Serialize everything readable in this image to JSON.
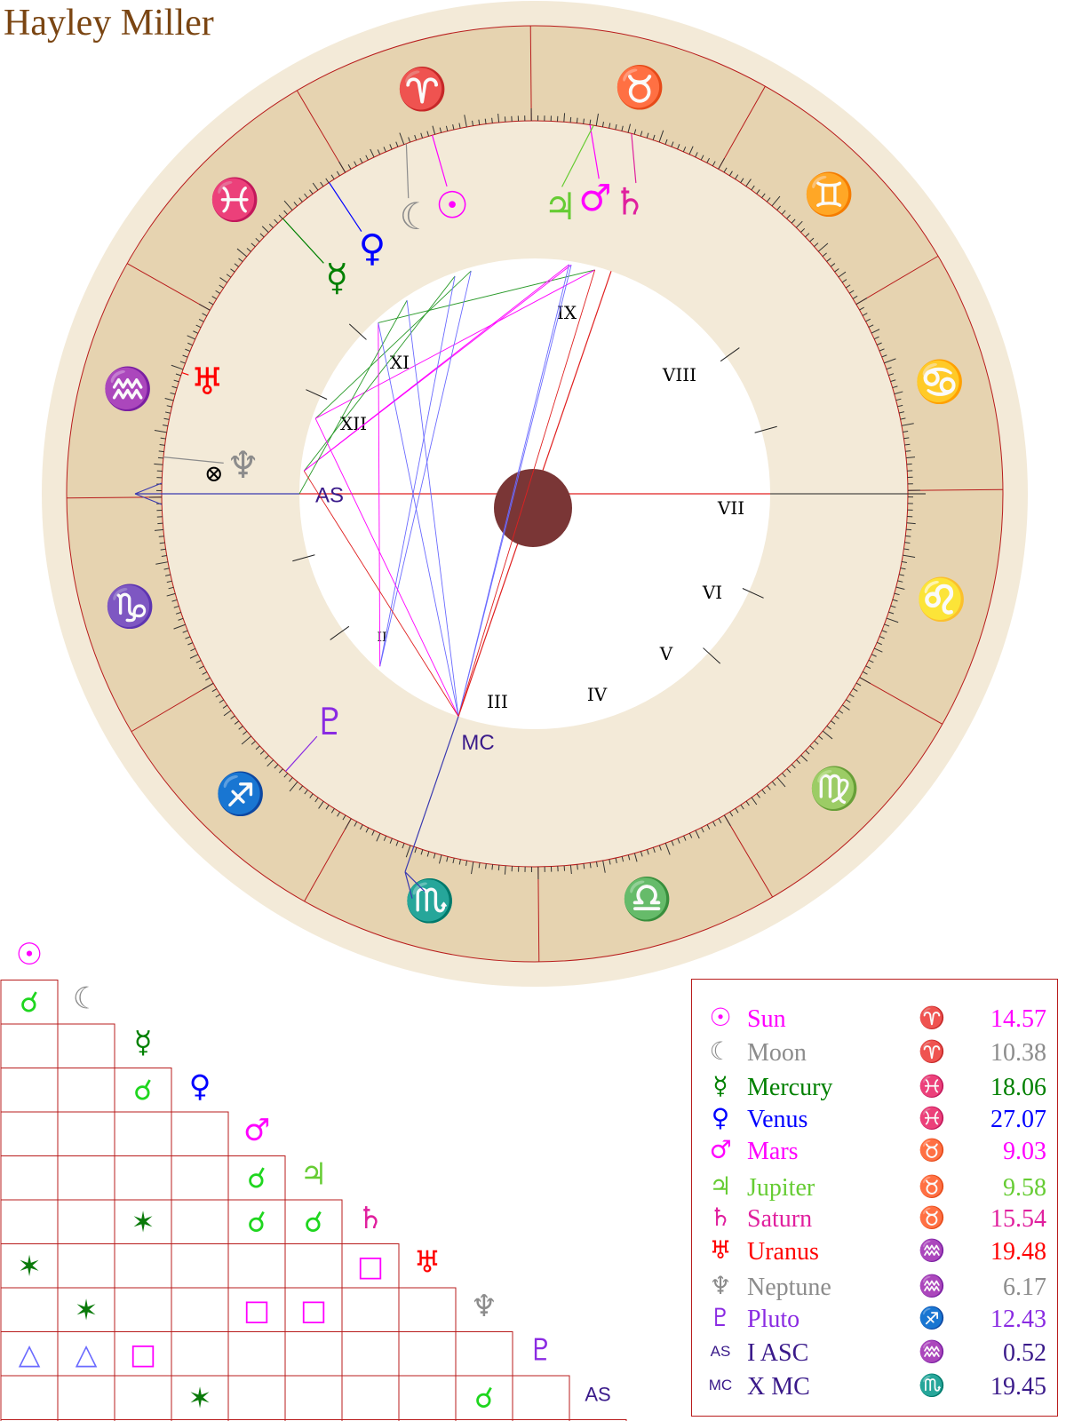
{
  "title": "Hayley Miller",
  "colors": {
    "ring_outer": "#f3ead8",
    "zodiac_band": "#e6d3b0",
    "house_band": "#f3ead8",
    "center": "#7a3636",
    "grid_line": "#b81c1c",
    "fire": "#ff1a1a",
    "earth": "#1fd61f",
    "air": "#e61ea8",
    "water": "#e61ea8",
    "sun": "#ff00ff",
    "moon": "#8c8c8c",
    "mercury": "#008000",
    "venus": "#0000ff",
    "mars": "#ff00ff",
    "jupiter": "#66cc33",
    "saturn": "#e0209e",
    "uranus": "#ff0000",
    "neptune": "#8c8c8c",
    "pluto": "#8a2be2",
    "asc": "#3a1a8a",
    "mc": "#3a1a8a"
  },
  "zodiac_signs": [
    {
      "name": "aries-sign-icon",
      "glyph": "♈",
      "color": "#ff1a1a"
    },
    {
      "name": "taurus-sign-icon",
      "glyph": "♉",
      "color": "#1fd61f"
    },
    {
      "name": "gemini-sign-icon",
      "glyph": "♊",
      "color": "#e61ea8"
    },
    {
      "name": "cancer-sign-icon",
      "glyph": "♋",
      "color": "#ff1a1a"
    },
    {
      "name": "leo-sign-icon",
      "glyph": "♌",
      "color": "#1fd61f"
    },
    {
      "name": "virgo-sign-icon",
      "glyph": "♍",
      "color": "#e61ea8"
    },
    {
      "name": "libra-sign-icon",
      "glyph": "♎",
      "color": "#ff1a1a"
    },
    {
      "name": "scorpio-sign-icon",
      "glyph": "♏",
      "color": "#1fd61f"
    },
    {
      "name": "sagittarius-sign-icon",
      "glyph": "♐",
      "color": "#e61ea8"
    },
    {
      "name": "capricorn-sign-icon",
      "glyph": "♑",
      "color": "#ff1a1a"
    },
    {
      "name": "aquarius-sign-icon",
      "glyph": "♒",
      "color": "#1fd61f"
    },
    {
      "name": "pisces-sign-icon",
      "glyph": "♓",
      "color": "#e61ea8"
    }
  ],
  "houses": [
    "I",
    "II",
    "III",
    "IV",
    "V",
    "VI",
    "VII",
    "VIII",
    "IX",
    "X",
    "XI",
    "XII"
  ],
  "house_labels_shown": [
    "II",
    "III",
    "IV",
    "V",
    "VI",
    "VII",
    "VIII",
    "IX",
    "XI",
    "XII"
  ],
  "angles": {
    "asc_label": "AS",
    "mc_label": "MC"
  },
  "fortune_glyph": "⊗",
  "planets": [
    {
      "key": "sun",
      "glyph": "☉",
      "name": "Sun",
      "sign_glyph": "♈",
      "degree": "14.57",
      "color": "#ff00ff"
    },
    {
      "key": "moon",
      "glyph": "☾",
      "name": "Moon",
      "sign_glyph": "♈",
      "degree": "10.38",
      "color": "#8c8c8c"
    },
    {
      "key": "mercury",
      "glyph": "☿",
      "name": "Mercury",
      "sign_glyph": "♓",
      "degree": "18.06",
      "color": "#008000"
    },
    {
      "key": "venus",
      "glyph": "♀",
      "name": "Venus",
      "sign_glyph": "♓",
      "degree": "27.07",
      "color": "#0000ff"
    },
    {
      "key": "mars",
      "glyph": "♂",
      "name": "Mars",
      "sign_glyph": "♉",
      "degree": "9.03",
      "color": "#ff00ff"
    },
    {
      "key": "jupiter",
      "glyph": "♃",
      "name": "Jupiter",
      "sign_glyph": "♉",
      "degree": "9.58",
      "color": "#66cc33"
    },
    {
      "key": "saturn",
      "glyph": "♄",
      "name": "Saturn",
      "sign_glyph": "♉",
      "degree": "15.54",
      "color": "#e0209e"
    },
    {
      "key": "uranus",
      "glyph": "♅",
      "name": "Uranus",
      "sign_glyph": "♒",
      "degree": "19.48",
      "color": "#ff0000"
    },
    {
      "key": "neptune",
      "glyph": "♆",
      "name": "Neptune",
      "sign_glyph": "♒",
      "degree": "6.17",
      "color": "#8c8c8c"
    },
    {
      "key": "pluto",
      "glyph": "♇",
      "name": "Pluto",
      "sign_glyph": "♐",
      "degree": "12.43",
      "color": "#8a2be2"
    },
    {
      "key": "asc",
      "glyph": "AS",
      "name": "I ASC",
      "sign_glyph": "♒",
      "degree": "0.52",
      "color": "#3a1a8a"
    },
    {
      "key": "mc",
      "glyph": "MC",
      "name": "X MC",
      "sign_glyph": "♏",
      "degree": "19.45",
      "color": "#3a1a8a"
    }
  ],
  "aspect_grid": {
    "labels": [
      "☉",
      "☾",
      "☿",
      "♀",
      "♂",
      "♃",
      "♄",
      "♅",
      "♆",
      "♇",
      "AS",
      "MC"
    ],
    "label_colors": [
      "#ff00ff",
      "#8c8c8c",
      "#008000",
      "#0000ff",
      "#ff00ff",
      "#66cc33",
      "#e0209e",
      "#ff0000",
      "#8c8c8c",
      "#8a2be2",
      "#3a1a8a",
      "#3a1a8a"
    ],
    "cells": [
      {
        "row": 1,
        "col": 0,
        "glyph": "☌",
        "color": "#1fd61f"
      },
      {
        "row": 3,
        "col": 2,
        "glyph": "☌",
        "color": "#1fd61f"
      },
      {
        "row": 5,
        "col": 4,
        "glyph": "☌",
        "color": "#1fd61f"
      },
      {
        "row": 6,
        "col": 2,
        "glyph": "✶",
        "color": "#0a7a0a"
      },
      {
        "row": 6,
        "col": 4,
        "glyph": "☌",
        "color": "#1fd61f"
      },
      {
        "row": 6,
        "col": 5,
        "glyph": "☌",
        "color": "#1fd61f"
      },
      {
        "row": 7,
        "col": 0,
        "glyph": "✶",
        "color": "#0a7a0a"
      },
      {
        "row": 7,
        "col": 6,
        "glyph": "□",
        "color": "#ff00ff"
      },
      {
        "row": 8,
        "col": 1,
        "glyph": "✶",
        "color": "#0a7a0a"
      },
      {
        "row": 8,
        "col": 4,
        "glyph": "□",
        "color": "#ff00ff"
      },
      {
        "row": 8,
        "col": 5,
        "glyph": "□",
        "color": "#ff00ff"
      },
      {
        "row": 9,
        "col": 0,
        "glyph": "△",
        "color": "#6a6aff"
      },
      {
        "row": 9,
        "col": 1,
        "glyph": "△",
        "color": "#6a6aff"
      },
      {
        "row": 9,
        "col": 2,
        "glyph": "□",
        "color": "#ff00ff"
      },
      {
        "row": 10,
        "col": 3,
        "glyph": "✶",
        "color": "#0a7a0a"
      },
      {
        "row": 10,
        "col": 8,
        "glyph": "☌",
        "color": "#1fd61f"
      },
      {
        "row": 11,
        "col": 2,
        "glyph": "△",
        "color": "#6a6aff"
      },
      {
        "row": 11,
        "col": 3,
        "glyph": "△",
        "color": "#6a6aff"
      },
      {
        "row": 11,
        "col": 4,
        "glyph": "△",
        "color": "#6a6aff"
      },
      {
        "row": 11,
        "col": 5,
        "glyph": "△",
        "color": "#6a6aff"
      },
      {
        "row": 11,
        "col": 6,
        "glyph": "☍",
        "color": "#ff1a1a"
      },
      {
        "row": 11,
        "col": 7,
        "glyph": "□",
        "color": "#ff00ff"
      },
      {
        "row": 11,
        "col": 8,
        "glyph": "☍",
        "color": "#ff1a1a"
      }
    ]
  }
}
